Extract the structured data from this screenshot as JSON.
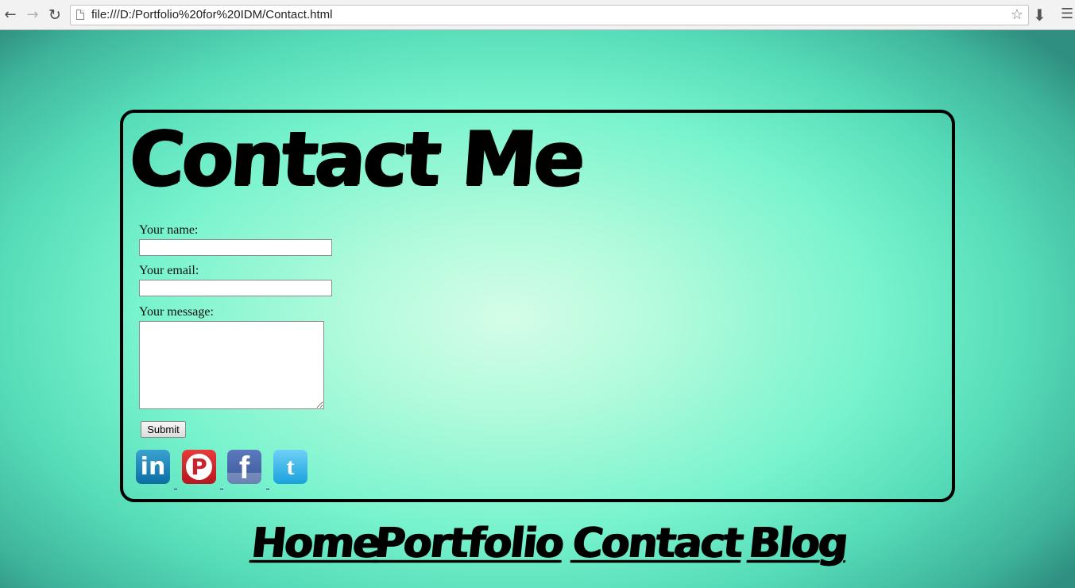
{
  "browser": {
    "url": "file:///D:/Portfolio%20for%20IDM/Contact.html",
    "icons": [
      "back-arrow-icon",
      "forward-arrow-icon",
      "reload-icon",
      "page-icon",
      "star-icon",
      "download-icon",
      "menu-icon"
    ]
  },
  "page": {
    "title": "Contact Me"
  },
  "form": {
    "name_label": "Your name:",
    "email_label": "Your email:",
    "message_label": "Your message:",
    "name_value": "",
    "email_value": "",
    "message_value": "",
    "submit_label": "Submit"
  },
  "social": {
    "icons": [
      "linkedin-icon",
      "pinterest-icon",
      "facebook-icon",
      "twitter-icon"
    ],
    "colors": {
      "linkedin": "#0c6ea3",
      "pinterest": "#c8232c",
      "facebook": "#3b5998",
      "twitter": "#1aa1dd"
    }
  },
  "nav": {
    "home": "Home",
    "portfolio": "Portfolio",
    "contact": "Contact",
    "blog": "Blog"
  },
  "theme": {
    "background_center": "#d4fde8",
    "background_edge": "#2f8f80",
    "border": "#000000"
  }
}
